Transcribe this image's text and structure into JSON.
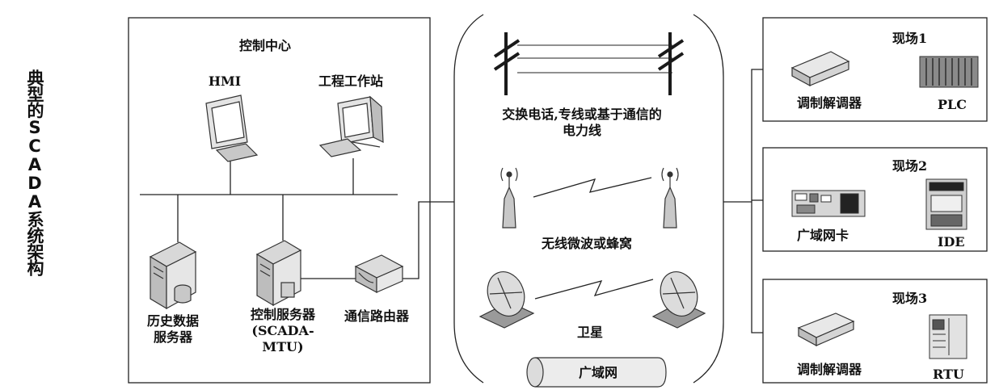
{
  "side_title": "典型的SCADA系统架构",
  "control_center": {
    "title": "控制中心",
    "hmi_label": "HMI",
    "workstation_label": "工程工作站",
    "history_server_label": [
      "历史数据",
      "服务器"
    ],
    "control_server_label": [
      "控制服务器",
      "(SCADA-",
      "MTU)"
    ],
    "router_label": "通信路由器"
  },
  "wan": {
    "powerline_label": [
      "交换电话,专线或基于通信的",
      "电力线"
    ],
    "wireless_label": "无线微波或蜂窝",
    "satellite_label": "卫星",
    "wan_label": "广域网"
  },
  "sites": [
    {
      "title": "现场1",
      "device_left": "调制解调器",
      "device_right": "PLC"
    },
    {
      "title": "现场2",
      "device_left": "广域网卡",
      "device_right": "IDE"
    },
    {
      "title": "现场3",
      "device_left": "调制解调器",
      "device_right": "RTU"
    }
  ],
  "colors": {
    "line": "#222222",
    "device": "#bdbdbd",
    "device_dark": "#5a5a5a",
    "box_border": "#222222"
  },
  "icons": [
    "monitor-icon",
    "workstation-icon",
    "server-icon",
    "router-icon",
    "power-pole-icon",
    "antenna-icon",
    "lightning-icon",
    "satellite-dish-icon",
    "modem-icon",
    "plc-icon",
    "wan-card-icon",
    "ide-icon",
    "rtu-icon"
  ]
}
